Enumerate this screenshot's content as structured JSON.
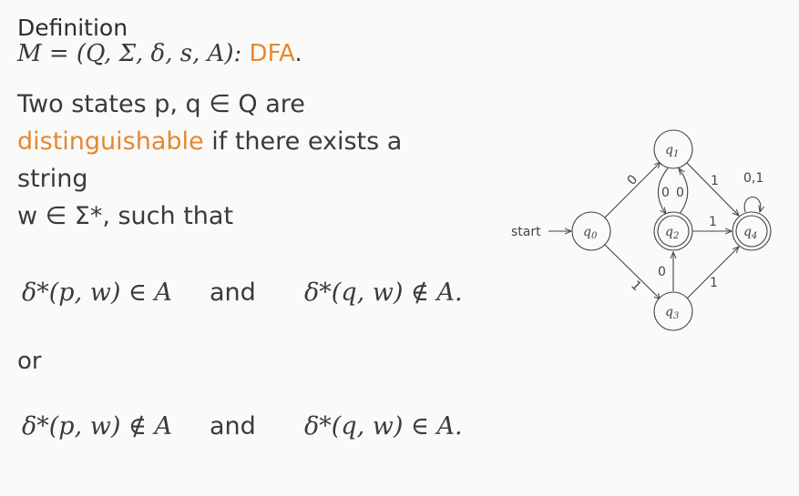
{
  "heading": "Definition",
  "definition_math": "M = (Q, Σ, δ, s, A):",
  "definition_term": "DFA",
  "definition_end": ".",
  "intro_line1": "Two states p, q ∈ Q are",
  "distinguishable_term": "distinguishable",
  "intro_line2_rest": " if there exists a string",
  "intro_line3": "w ∈ Σ*, such that",
  "case1": {
    "left": "δ*(p, w) ∈ A",
    "conj": "and",
    "right": "δ*(q, w) ∉ A."
  },
  "or_label": "or",
  "case2": {
    "left": "δ*(p, w) ∉ A",
    "conj": "and",
    "right": "δ*(q, w) ∈ A."
  },
  "automaton": {
    "start_label": "start",
    "states": [
      "q0",
      "q1",
      "q2",
      "q3",
      "q4"
    ],
    "accepting": [
      "q2",
      "q4"
    ],
    "transitions": [
      {
        "from": "q0",
        "to": "q1",
        "label": "0"
      },
      {
        "from": "q0",
        "to": "q3",
        "label": "1"
      },
      {
        "from": "q1",
        "to": "q2",
        "label": "0"
      },
      {
        "from": "q2",
        "to": "q1",
        "label": "0"
      },
      {
        "from": "q1",
        "to": "q4",
        "label": "1"
      },
      {
        "from": "q2",
        "to": "q4",
        "label": "1"
      },
      {
        "from": "q3",
        "to": "q2",
        "label": "0"
      },
      {
        "from": "q3",
        "to": "q4",
        "label": "1"
      },
      {
        "from": "q4",
        "to": "q4",
        "label": "0,1"
      }
    ]
  }
}
